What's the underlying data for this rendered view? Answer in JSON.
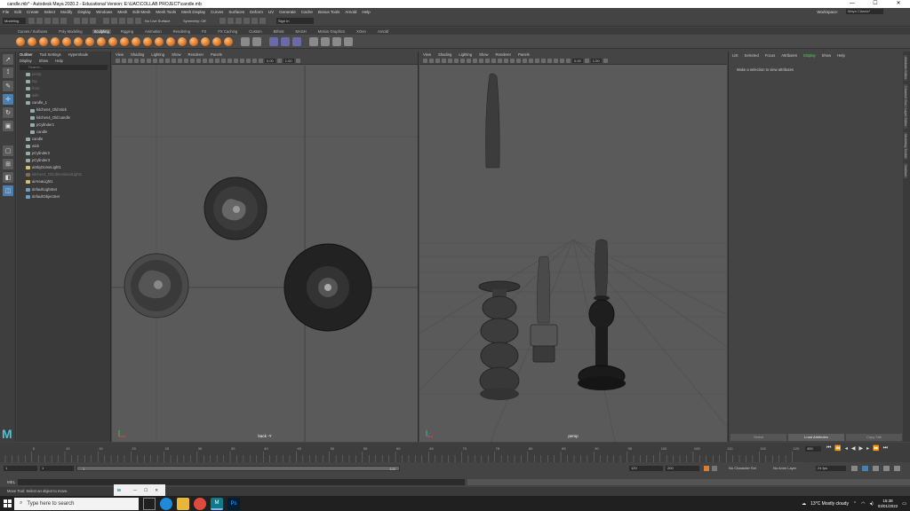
{
  "window": {
    "title": "candle.mb* - Autodesk Maya 2020.2 - Educational Version: E:\\UAC\\COLLAB PROJECT\\candle.mb",
    "controls": [
      "—",
      "☐",
      "✕"
    ]
  },
  "menubar": {
    "items": [
      "File",
      "Edit",
      "Create",
      "Select",
      "Modify",
      "Display",
      "Windows",
      "Mesh",
      "Edit Mesh",
      "Mesh Tools",
      "Mesh Display",
      "Curves",
      "Surfaces",
      "Deform",
      "UV",
      "Generate",
      "Cache",
      "Bonus Tools",
      "Arnold",
      "Help"
    ],
    "workspace_label": "Workspace:",
    "workspace_value": "Maya Classic*"
  },
  "statusline": {
    "mode": "Modeling",
    "live_surface": "No Live Surface",
    "symmetry": "Symmetry: Off",
    "sign_in": "Sign In"
  },
  "shelf": {
    "tabs": [
      "Curves / Surfaces",
      "Poly Modeling",
      "Sculpting",
      "Rigging",
      "Animation",
      "Rendering",
      "FX",
      "FX Caching",
      "Custom",
      "Bifrost",
      "MASH",
      "Motion Graphics",
      "XGen",
      "Arnold"
    ],
    "active_tab": "Sculpting"
  },
  "outliner": {
    "tabs": [
      "Outliner",
      "Tool Settings",
      "Hypershade"
    ],
    "menu": [
      "Display",
      "Show",
      "Help"
    ],
    "search_placeholder": "Search...",
    "items": [
      {
        "label": "persp",
        "dim": true,
        "sub": false
      },
      {
        "label": "top",
        "dim": true,
        "sub": false
      },
      {
        "label": "front",
        "dim": true,
        "sub": false
      },
      {
        "label": "side",
        "dim": true,
        "sub": false
      },
      {
        "label": "candle_1",
        "dim": false,
        "sub": false
      },
      {
        "label": "kitchen4_Old:stick",
        "dim": false,
        "sub": true
      },
      {
        "label": "kitchen4_Old:candle",
        "dim": false,
        "sub": true
      },
      {
        "label": "pCylinder1",
        "dim": false,
        "sub": true
      },
      {
        "label": "candle",
        "dim": false,
        "sub": true
      },
      {
        "label": "candle",
        "dim": false,
        "sub": false
      },
      {
        "label": "wick",
        "dim": false,
        "sub": false
      },
      {
        "label": "pCylinder2",
        "dim": false,
        "sub": false
      },
      {
        "label": "pCylinder3",
        "dim": false,
        "sub": false
      },
      {
        "label": "aiSkyDomeLight1",
        "dim": false,
        "sub": false
      },
      {
        "label": "kitchen4_Old:directionalLight1",
        "dim": true,
        "sub": false
      },
      {
        "label": "aiAreaLight1",
        "dim": false,
        "sub": false
      },
      {
        "label": "defaultLightSet",
        "dim": false,
        "sub": false
      },
      {
        "label": "defaultObjectSet",
        "dim": false,
        "sub": false
      }
    ]
  },
  "viewports": {
    "menu": [
      "View",
      "Shading",
      "Lighting",
      "Show",
      "Renderer",
      "Panels"
    ],
    "near_value": "0.00",
    "far_value": "1.00",
    "left_camera": "back -Y",
    "right_camera": "persp"
  },
  "attribute_editor": {
    "tabs": [
      "List",
      "Selected",
      "Focus",
      "Attributes",
      "Display",
      "Show",
      "Help"
    ],
    "active_tab": "Display",
    "message": "Make a selection to view attributes",
    "buttons": [
      "Select",
      "Load Attributes",
      "Copy Tab"
    ]
  },
  "side_tabs": [
    "Attribute Editor",
    "Channel Box / Layer Editor",
    "Modeling Toolkit",
    "Outliner"
  ],
  "timeslider": {
    "current_frame": "450",
    "ticks": [
      "5",
      "10",
      "15",
      "20",
      "25",
      "30",
      "35",
      "40",
      "45",
      "50",
      "55",
      "60",
      "65",
      "70",
      "75",
      "80",
      "85",
      "90",
      "95",
      "100",
      "105",
      "110",
      "115",
      "120"
    ]
  },
  "range": {
    "start": "1",
    "playback_start": "1",
    "bar_start": "1",
    "bar_end": "120",
    "playback_end": "120",
    "end": "200",
    "character_set": "No Character Set",
    "anim_layer": "No Anim Layer",
    "fps": "24 fps"
  },
  "cmdline": {
    "label": "MEL"
  },
  "helpline": {
    "text": "Move Tool: Select an object to move."
  },
  "taskbar": {
    "search_placeholder": "Type here to search",
    "weather": "13°C  Mostly cloudy",
    "time": "15:38",
    "date": "03/01/2022"
  },
  "colors": {
    "accent": "#4a7fb0",
    "active_tab": "#64c864",
    "viewport_bg": "#5a5a5a"
  }
}
